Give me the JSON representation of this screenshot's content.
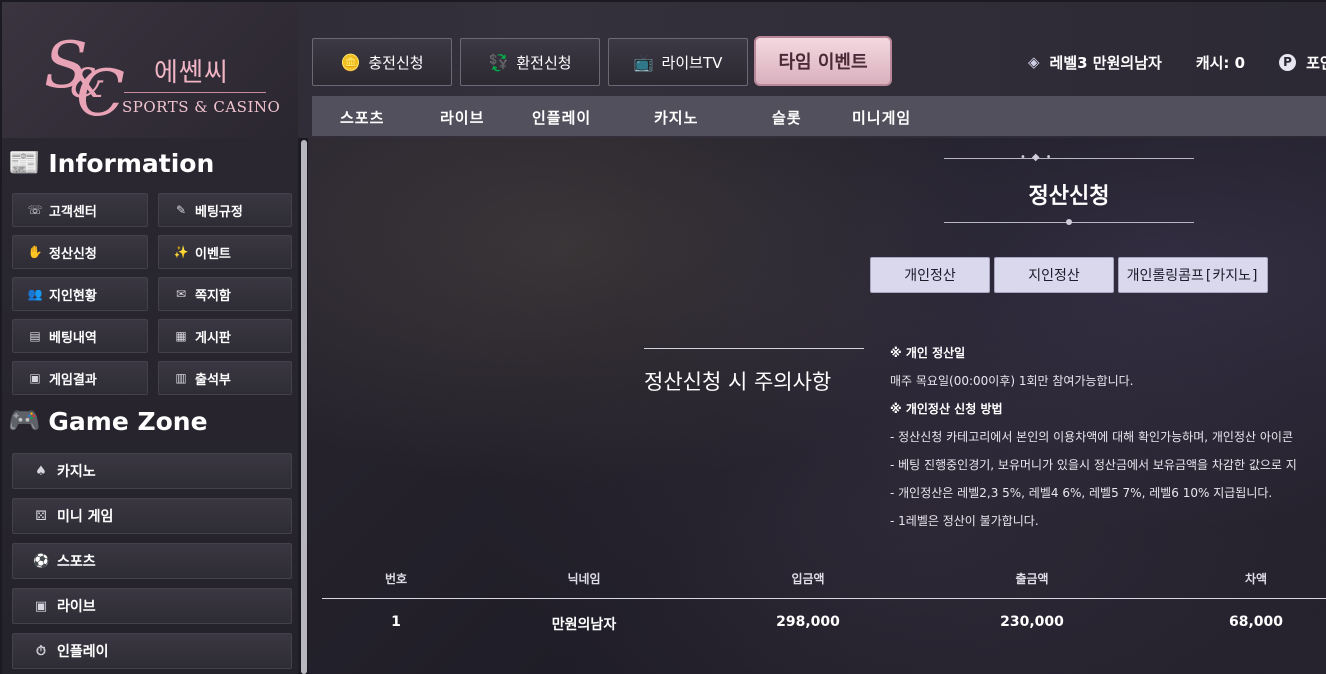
{
  "header": {
    "logo": {
      "mark": "S&C",
      "korean": "에쎈씨",
      "english": "SPORTS & CASINO"
    },
    "top_buttons": [
      {
        "label": "충전신청",
        "icon": "coins-icon"
      },
      {
        "label": "환전신청",
        "icon": "exchange-icon"
      },
      {
        "label": "라이브TV",
        "icon": "live-tv-icon"
      }
    ],
    "event_button": "타임 이벤트",
    "user": {
      "level_name": "레벨3 만원의남자",
      "cash": "캐시: 0",
      "point": "포인트"
    },
    "subnav": [
      "스포츠",
      "라이브",
      "인플레이",
      "카지노",
      "슬롯",
      "미니게임"
    ]
  },
  "sidebar": {
    "info_heading": "Information",
    "info_items": [
      {
        "label": "고객센터",
        "icon": "phone-icon"
      },
      {
        "label": "베팅규정",
        "icon": "rules-icon"
      },
      {
        "label": "정산신청",
        "icon": "settlement-icon"
      },
      {
        "label": "이벤트",
        "icon": "event-icon"
      },
      {
        "label": "지인현황",
        "icon": "friends-icon"
      },
      {
        "label": "쪽지함",
        "icon": "message-icon"
      },
      {
        "label": "베팅내역",
        "icon": "history-icon"
      },
      {
        "label": "게시판",
        "icon": "board-icon"
      },
      {
        "label": "게임결과",
        "icon": "result-icon"
      },
      {
        "label": "출석부",
        "icon": "calendar-icon"
      }
    ],
    "game_heading": "Game Zone",
    "game_items": [
      {
        "label": "카지노",
        "icon": "spade-icon"
      },
      {
        "label": "미니 게임",
        "icon": "mini-game-icon"
      },
      {
        "label": "스포츠",
        "icon": "sports-icon"
      },
      {
        "label": "라이브",
        "icon": "live-icon"
      },
      {
        "label": "인플레이",
        "icon": "inplay-icon"
      }
    ]
  },
  "main": {
    "title": "정산신청",
    "tabs": [
      "개인정산",
      "지인정산",
      "개인롤링콤프[카지노]"
    ],
    "notice_heading": "정산신청 시 주의사항",
    "notices": [
      {
        "text": "※ 개인 정산일",
        "bold": true
      },
      {
        "text": "매주 목요일(00:00이후) 1회만 참여가능합니다.",
        "bold": false
      },
      {
        "text": "※ 개인정산 신청 방법",
        "bold": true
      },
      {
        "text": "- 정산신청 카테고리에서 본인의 이용차액에 대해 확인가능하며, 개인정산 아이콘",
        "bold": false
      },
      {
        "text": "- 베팅 진행중인경기, 보유머니가 있을시 정산금에서 보유금액을 차감한 값으로 지",
        "bold": false
      },
      {
        "text": "- 개인정산은 레벨2,3 5%, 레벨4 6%, 레벨5 7%, 레벨6 10% 지급됩니다.",
        "bold": false
      },
      {
        "text": "- 1레벨은 정산이 불가합니다.",
        "bold": false
      }
    ],
    "table": {
      "headers": [
        "번호",
        "닉네임",
        "입금액",
        "출금액",
        "차액"
      ],
      "rows": [
        [
          "1",
          "만원의남자",
          "298,000",
          "230,000",
          "68,000"
        ]
      ]
    }
  }
}
